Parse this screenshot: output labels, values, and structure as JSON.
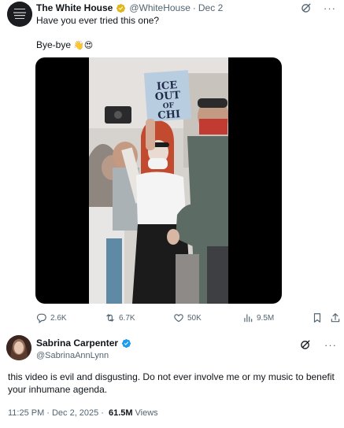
{
  "quoted_post": {
    "author_name": "The White House",
    "handle": "@WhiteHouse",
    "separator": "·",
    "date": "Dec 2",
    "avatar_text": "THE WHITE HOUSE",
    "line1": "Have you ever tried this one?",
    "line2": "Bye-bye",
    "line2_emojis": "👋😍",
    "video": {
      "sign_lines": [
        "ICE",
        "OUT",
        "OF",
        "CHI"
      ]
    },
    "actions": {
      "replies": "2.6K",
      "reposts": "6.7K",
      "likes": "50K",
      "views": "9.5M"
    }
  },
  "main_post": {
    "author_name": "Sabrina Carpenter",
    "handle": "@SabrinaAnnLynn",
    "text": "this video is evil and disgusting. Do not ever involve me or my music to benefit your inhumane agenda.",
    "time": "11:25 PM",
    "separator": "·",
    "date": "Dec 2, 2025",
    "meta_separator": "·",
    "views_count": "61.5M",
    "views_label": "Views"
  },
  "colors": {
    "text": "#0f1419",
    "muted": "#536471",
    "verified_blue": "#1d9bf0",
    "verified_gold": "#e2b719"
  },
  "icons": [
    "grok-icon",
    "more-icon",
    "reply-icon",
    "repost-icon",
    "like-icon",
    "views-icon",
    "bookmark-icon",
    "share-icon",
    "verified-badge-icon"
  ]
}
